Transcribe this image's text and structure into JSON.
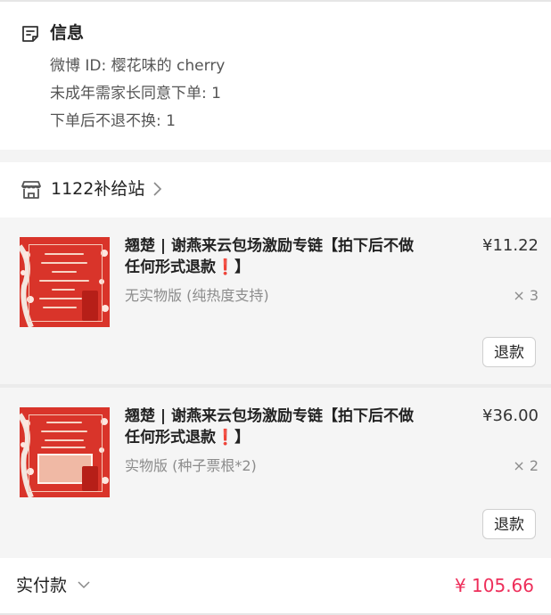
{
  "info": {
    "title": "信息",
    "lines": [
      "微博 ID: 樱花味的 cherry",
      "未成年需家长同意下单: 1",
      "下单后不退不换: 1"
    ]
  },
  "shop": {
    "name": "1122补给站"
  },
  "products": [
    {
      "title": "翘楚 | 谢燕来云包场激励专链【拍下后不做任何形式退款❗】",
      "price": "¥11.22",
      "variant": "无实物版 (纯热度支持)",
      "qty": "× 3",
      "refund_label": "退款"
    },
    {
      "title": "翘楚 | 谢燕来云包场激励专链【拍下后不做任何形式退款❗】",
      "price": "¥36.00",
      "variant": "实物版 (种子票根*2)",
      "qty": "× 2",
      "refund_label": "退款"
    }
  ],
  "total": {
    "label": "实付款",
    "amount": "¥ 105.66"
  },
  "colors": {
    "accent": "#ee2e5a",
    "thumb_red": "#d9342a"
  }
}
